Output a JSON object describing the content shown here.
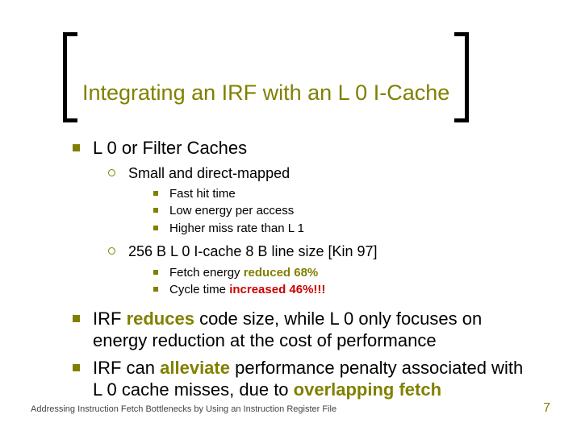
{
  "title": "Integrating an IRF with an L 0 I-Cache",
  "bullets": {
    "b1": "L 0 or Filter Caches",
    "b1_1": "Small and direct-mapped",
    "b1_1_1": "Fast hit time",
    "b1_1_2": "Low energy per access",
    "b1_1_3": "Higher miss rate than L 1",
    "b1_2": "256 B L 0 I-cache 8 B line size [Kin 97]",
    "b1_2_1_pre": "Fetch energy ",
    "b1_2_1_hi": "reduced 68%",
    "b1_2_2_pre": "Cycle time ",
    "b1_2_2_hi": "increased 46%!!!",
    "b2_a": "IRF ",
    "b2_b": "reduces",
    "b2_c": " code size, while L 0 only focuses on energy reduction at the cost of performance",
    "b3_a": "IRF can ",
    "b3_b": "alleviate",
    "b3_c": " performance penalty associated with L 0 cache misses, due to ",
    "b3_d": "overlapping fetch"
  },
  "footer": "Addressing Instruction Fetch Bottlenecks by Using an Instruction Register File",
  "page": "7"
}
